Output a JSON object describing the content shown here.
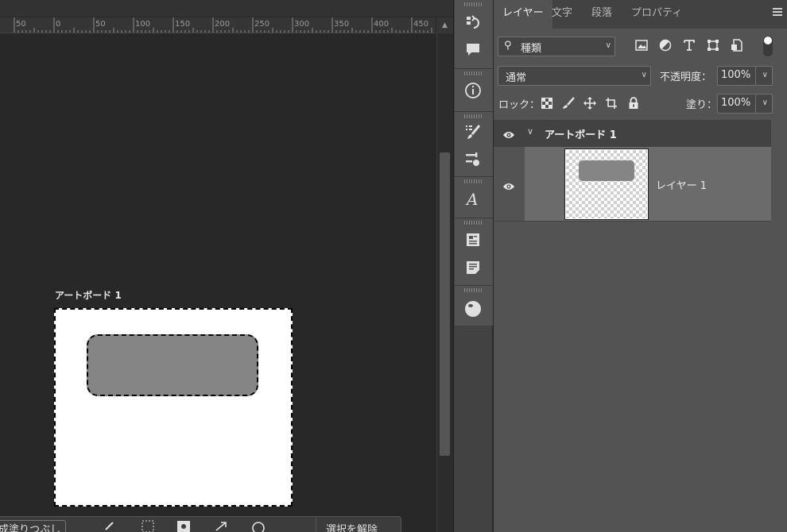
{
  "ruler": {
    "labels": [
      "50",
      "0",
      "50",
      "100",
      "150",
      "200",
      "250",
      "300",
      "350",
      "400",
      "450"
    ]
  },
  "canvas": {
    "artboard_label": "アートボード 1"
  },
  "taskbar": {
    "fill_label": "生成塗りつぶし",
    "deselect_label": "選択を解除"
  },
  "panel": {
    "tabs": [
      "レイヤー",
      "文字",
      "段落",
      "プロパティ"
    ],
    "active_tab": 0,
    "filter": {
      "value": "種類"
    },
    "blend_mode": {
      "value": "通常"
    },
    "opacity": {
      "label": "不透明度：",
      "value": "100%"
    },
    "lock": {
      "label": "ロック："
    },
    "fill": {
      "label": "塗り：",
      "value": "100%"
    },
    "group": {
      "name": "アートボード 1"
    },
    "layer": {
      "name": "レイヤー 1"
    }
  },
  "colors": {
    "accent_shape": "#858585",
    "panel_bg": "#535353",
    "canvas_bg": "#282828"
  }
}
